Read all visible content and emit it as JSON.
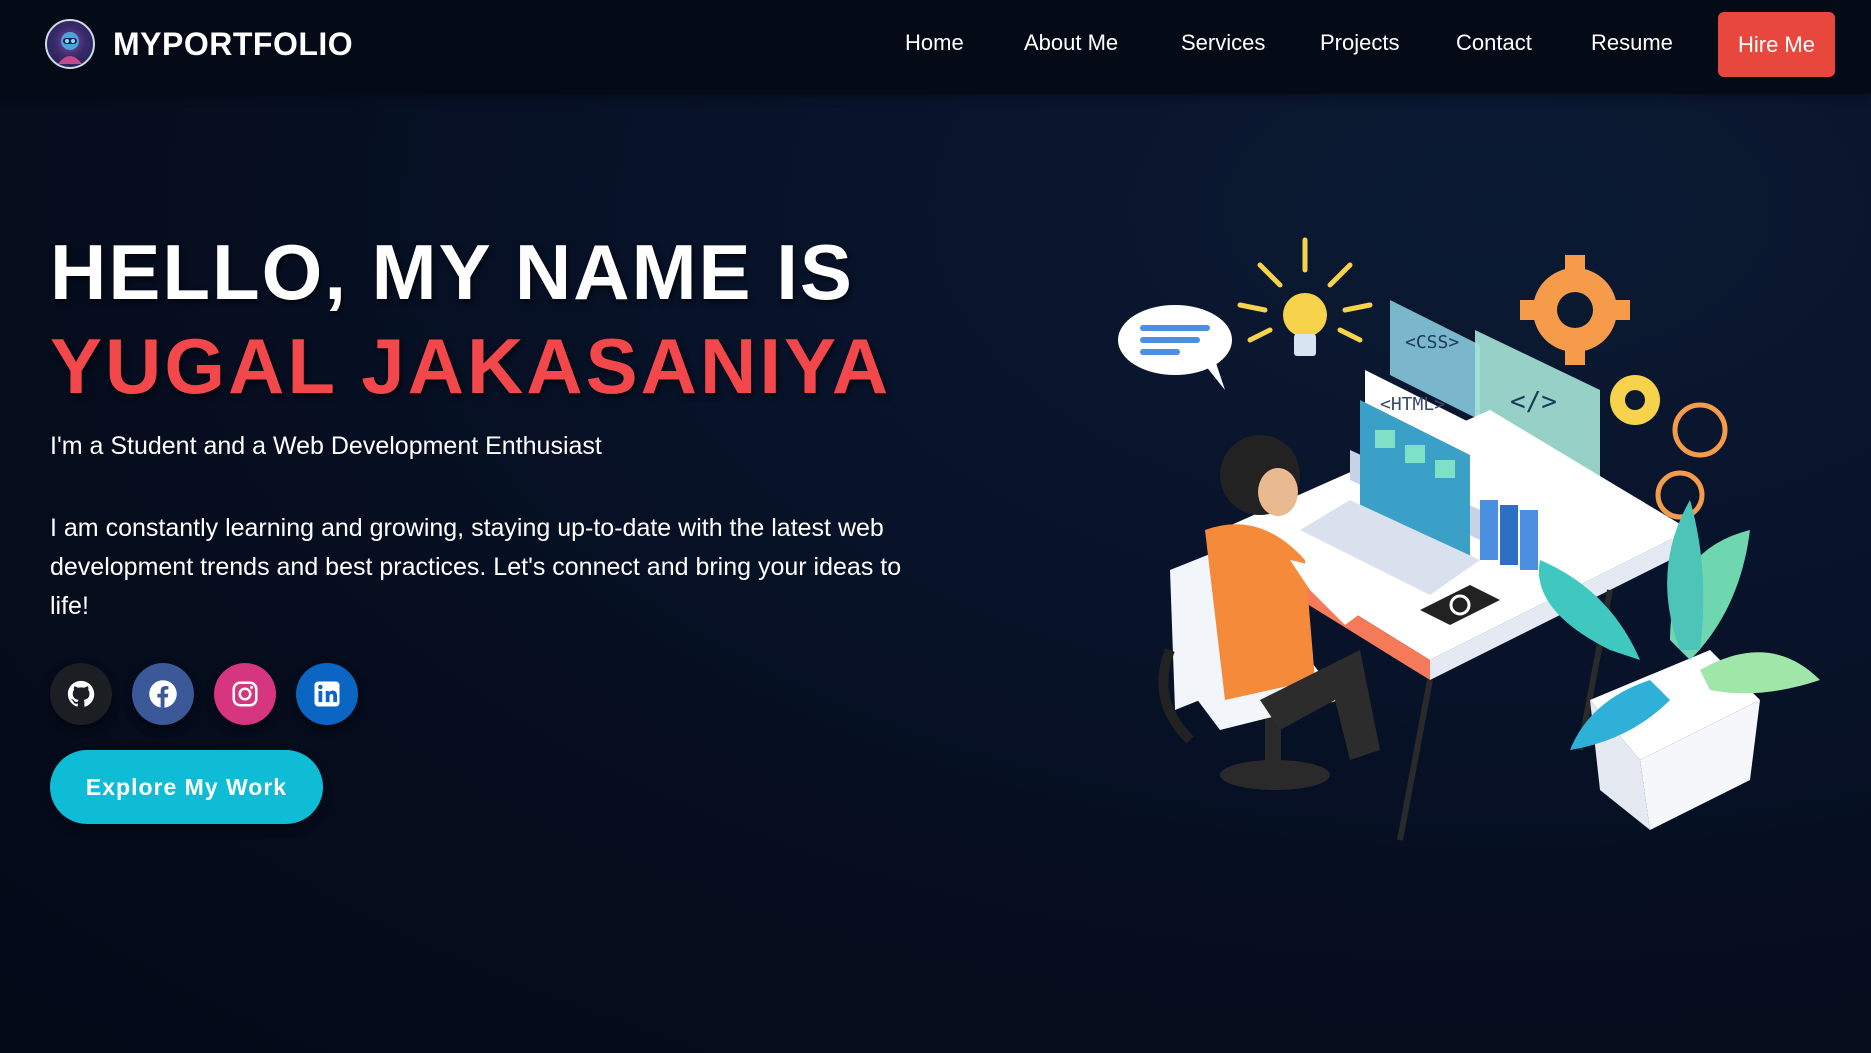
{
  "navbar": {
    "brand": "MYPORTFOLIO",
    "links": [
      "Home",
      "About Me",
      "Services",
      "Projects",
      "Contact",
      "Resume"
    ],
    "hire_label": "Hire Me"
  },
  "hero": {
    "greeting": "HELLO, MY NAME IS",
    "name": "YUGAL JAKASANIYA",
    "tagline": "I'm a Student and a Web Development Enthusiast",
    "description": "I am constantly learning and growing, staying up-to-date with the latest web development trends and best practices. Let's connect and bring your ideas to life!",
    "cta_label": "Explore My Work"
  },
  "illustration": {
    "css_label": "<CSS>",
    "html_label": "<HTML>",
    "code_label": "</>"
  },
  "socials": [
    {
      "icon": "github-icon",
      "color": "#1b1f24"
    },
    {
      "icon": "facebook-icon",
      "color": "#3b5998"
    },
    {
      "icon": "instagram-icon",
      "color": "#d6367f"
    },
    {
      "icon": "linkedin-icon",
      "color": "#0a66c2"
    }
  ],
  "colors": {
    "accent_red": "#f2474b",
    "hire_button": "#e8473e",
    "cta_button": "#0fbcd6"
  }
}
